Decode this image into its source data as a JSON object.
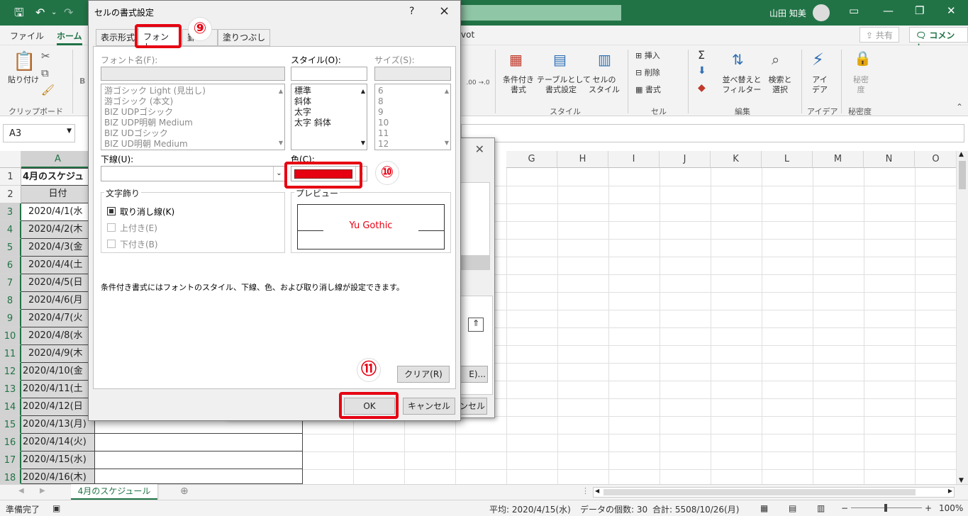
{
  "app": {
    "user_name": "山田 知美",
    "tabs": [
      "ファイル",
      "ホーム"
    ],
    "tab_pivot_fragment": "vot",
    "share_label": "共有",
    "comment_label": "コメント"
  },
  "ribbon": {
    "paste_label": "貼り付け",
    "clipboard_group": "クリップボード",
    "number_fragment": ".00 →.0",
    "conditional_format": "条件付き\n書式",
    "table_format": "テーブルとして\n書式設定",
    "cell_style": "セルの\nスタイル",
    "style_group": "スタイル",
    "insert": "挿入",
    "delete": "削除",
    "format": "書式",
    "cells_group": "セル",
    "sort_filter": "並べ替えと\nフィルター",
    "find_select": "検索と\n選択",
    "editing_group": "編集",
    "ideas": "アイ\nデア",
    "ideas_group": "アイデア",
    "sensitivity": "秘密\n度",
    "sensitivity_group": "秘密度",
    "font_fragment": "B"
  },
  "formula_bar": {
    "name_box": "A3"
  },
  "grid": {
    "columns": [
      "A",
      "G",
      "H",
      "I",
      "J",
      "K",
      "L",
      "M",
      "N",
      "O"
    ],
    "rows": [
      "1",
      "2",
      "3",
      "4",
      "5",
      "6",
      "7",
      "8",
      "9",
      "10",
      "11",
      "12",
      "13",
      "14",
      "15",
      "16",
      "17",
      "18"
    ],
    "cells_a": [
      "4月のスケジュ",
      "日付",
      "2020/4/1(水",
      "2020/4/2(木",
      "2020/4/3(金",
      "2020/4/4(土",
      "2020/4/5(日",
      "2020/4/6(月",
      "2020/4/7(火",
      "2020/4/8(水",
      "2020/4/9(木",
      "2020/4/10(金",
      "2020/4/11(土",
      "2020/4/12(日",
      "2020/4/13(月)",
      "2020/4/14(火)",
      "2020/4/15(水)",
      "2020/4/16(木)"
    ]
  },
  "sheet": {
    "tab": "4月のスケジュール"
  },
  "status": {
    "ready": "準備完了",
    "average": "平均: 2020/4/15(水)",
    "count": "データの個数: 30",
    "sum": "合計: 5508/10/26(月)",
    "zoom": "100%"
  },
  "back_dialog": {
    "button_fragment": "E)...",
    "cancel_fragment": "ンセル"
  },
  "dialog": {
    "title": "セルの書式設定",
    "help": "?",
    "close": "×",
    "tabs": [
      "表示形式",
      "フォント",
      "罫",
      "塗りつぶし"
    ],
    "font_name_label": "フォント名(F):",
    "font_list": [
      "游ゴシック Light (見出し)",
      "游ゴシック (本文)",
      "BIZ UDPゴシック",
      "BIZ UDP明朝 Medium",
      "BIZ UDゴシック",
      "BIZ UD明朝 Medium"
    ],
    "style_label": "スタイル(O):",
    "style_list": [
      "標準",
      "斜体",
      "太字",
      "太字 斜体"
    ],
    "size_label": "サイズ(S):",
    "size_list": [
      "6",
      "8",
      "9",
      "10",
      "11",
      "12"
    ],
    "underline_label": "下線(U):",
    "color_label": "色(C):",
    "selected_color": "#e60012",
    "effects_label": "文字飾り",
    "strikethrough": "取り消し線(K)",
    "superscript": "上付き(E)",
    "subscript": "下付き(B)",
    "preview_label": "プレビュー",
    "preview_text": "Yu Gothic",
    "note": "条件付き書式にはフォントのスタイル、下線、色、および取り消し線が設定できます。",
    "clear_button": "クリア(R)",
    "ok_button": "OK",
    "cancel_button": "キャンセル"
  },
  "annotations": {
    "step9": "⑨",
    "step10": "⑩",
    "step11": "⑪",
    "highlight_color": "#e60012"
  }
}
